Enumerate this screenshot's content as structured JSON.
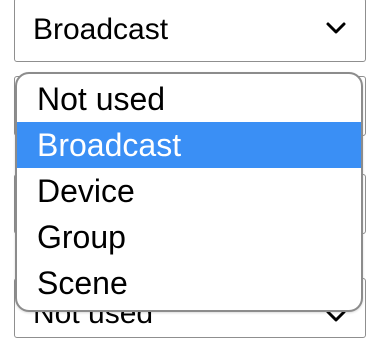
{
  "select_top": {
    "value": "Broadcast",
    "icon": "chevron-down-icon"
  },
  "dropdown": {
    "options": [
      {
        "label": "Not used",
        "selected": false
      },
      {
        "label": "Broadcast",
        "selected": true
      },
      {
        "label": "Device",
        "selected": false
      },
      {
        "label": "Group",
        "selected": false
      },
      {
        "label": "Scene",
        "selected": false
      }
    ],
    "highlight_color": "#3a8ff5"
  },
  "select_bottom": {
    "value": "Not used",
    "icon": "chevron-down-icon"
  }
}
